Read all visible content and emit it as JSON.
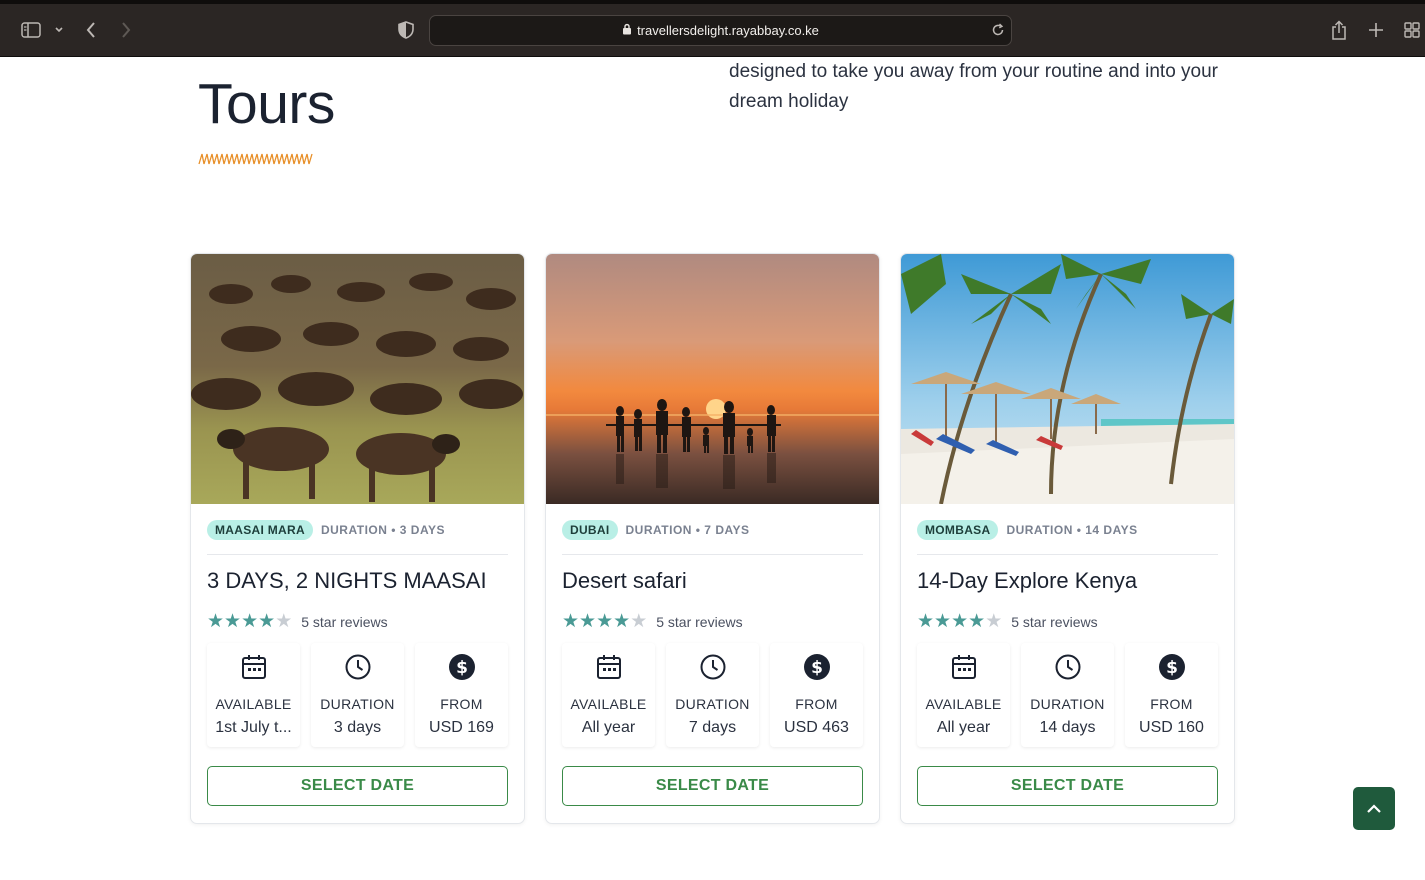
{
  "browser": {
    "url": "travellersdelight.rayabbay.co.ke"
  },
  "page": {
    "heading": "Tours",
    "intro": "designed to take you away from your routine and into your dream holiday"
  },
  "colors": {
    "badge_bg": "#b9efe6",
    "accent_green": "#3a8a48",
    "star_teal": "#4a9a95",
    "back_to_top": "#1f5a3c",
    "squiggle_orange": "#e8902a"
  },
  "cards": [
    {
      "location": "MAASAI MARA",
      "duration_meta": "DURATION • 3 DAYS",
      "title": "3 DAYS, 2 NIGHTS MAASAI",
      "rating": 4,
      "reviews": "5 star reviews",
      "available_label": "AVAILABLE",
      "available_value": "1st July t...",
      "duration_label": "DURATION",
      "duration_value": "3 days",
      "from_label": "FROM",
      "from_value": "USD 169",
      "button": "SELECT DATE"
    },
    {
      "location": "DUBAI",
      "duration_meta": "DURATION • 7 DAYS",
      "title": "Desert safari",
      "rating": 4,
      "reviews": "5 star reviews",
      "available_label": "AVAILABLE",
      "available_value": "All year",
      "duration_label": "DURATION",
      "duration_value": "7 days",
      "from_label": "FROM",
      "from_value": "USD 463",
      "button": "SELECT DATE"
    },
    {
      "location": "MOMBASA",
      "duration_meta": "DURATION • 14 DAYS",
      "title": "14-Day Explore Kenya",
      "rating": 4,
      "reviews": "5 star reviews",
      "available_label": "AVAILABLE",
      "available_value": "All year",
      "duration_label": "DURATION",
      "duration_value": "14 days",
      "from_label": "FROM",
      "from_value": "USD 160",
      "button": "SELECT DATE"
    }
  ]
}
